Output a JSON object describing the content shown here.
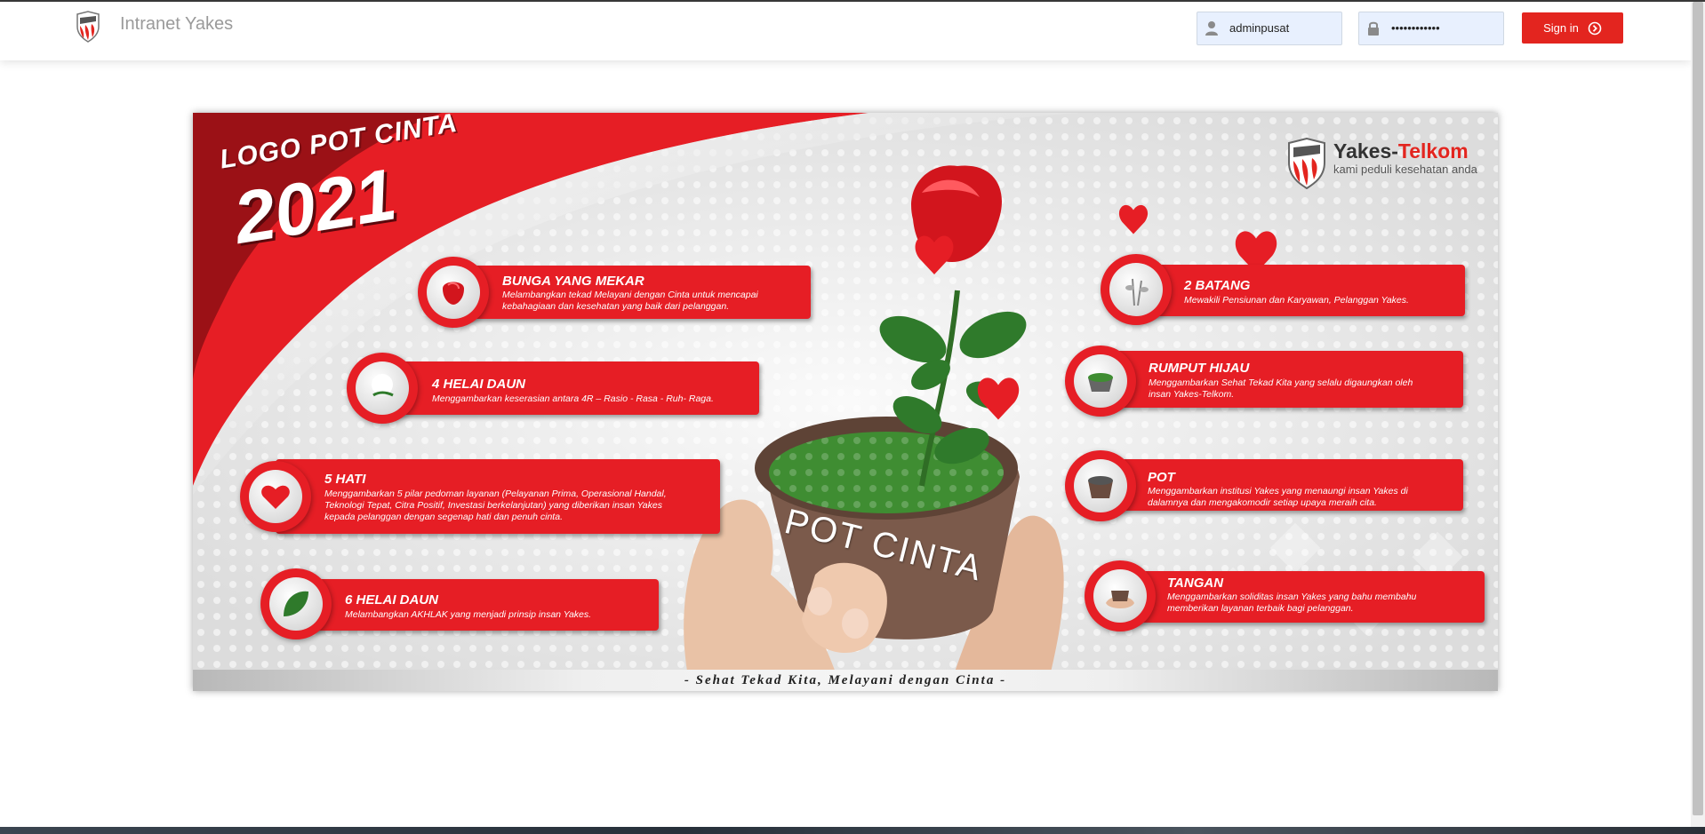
{
  "app": {
    "title": "Intranet Yakes"
  },
  "login": {
    "username": {
      "value": "adminpusat"
    },
    "password": {
      "value": "••••••••••••"
    },
    "signin_label": "Sign in"
  },
  "banner": {
    "title_small": "LOGO POT CINTA",
    "title_year": "2021",
    "brand_name_1": "Yakes-",
    "brand_name_2": "Telkom",
    "brand_tagline": "kami peduli kesehatan anda",
    "pot_label": "POT CINTA",
    "tagline": "- Sehat Tekad Kita, Melayani dengan Cinta -",
    "items": [
      {
        "title": "BUNGA YANG MEKAR",
        "desc": "Melambangkan tekad Melayani dengan Cinta untuk mencapai kebahagiaan dan kesehatan yang baik dari pelanggan.",
        "icon": "rose-icon"
      },
      {
        "title": "4 HELAI DAUN",
        "desc": "Menggambarkan keserasian antara 4R – Rasio - Rasa - Ruh- Raga.",
        "icon": "leaves-icon"
      },
      {
        "title": "5 HATI",
        "desc": "Menggambarkan 5 pilar pedoman layanan (Pelayanan Prima, Operasional Handal, Teknologi Tepat, Citra Positif, Investasi berkelanjutan) yang diberikan insan Yakes kepada pelanggan dengan segenap hati dan penuh cinta.",
        "icon": "heart-icon"
      },
      {
        "title": "6 HELAI DAUN",
        "desc": "Melambangkan AKHLAK yang menjadi prinsip insan Yakes.",
        "icon": "leaf-icon"
      },
      {
        "title": "2 BATANG",
        "desc": "Mewakili Pensiunan dan Karyawan, Pelanggan Yakes.",
        "icon": "stems-icon"
      },
      {
        "title": "RUMPUT HIJAU",
        "desc": "Menggambarkan Sehat Tekad Kita yang selalu digaungkan oleh insan Yakes-Telkom.",
        "icon": "grass-icon"
      },
      {
        "title": "POT",
        "desc": "Menggambarkan institusi Yakes yang menaungi insan Yakes di dalamnya dan mengakomodir setiap upaya meraih cita.",
        "icon": "pot-icon"
      },
      {
        "title": "TANGAN",
        "desc": "Menggambarkan soliditas insan Yakes yang bahu membahu memberikan layanan terbaik bagi pelanggan.",
        "icon": "hands-icon"
      }
    ]
  },
  "colors": {
    "accent": "#e3251f",
    "banner_red": "#e61e25",
    "dark_red": "#9b1116"
  }
}
